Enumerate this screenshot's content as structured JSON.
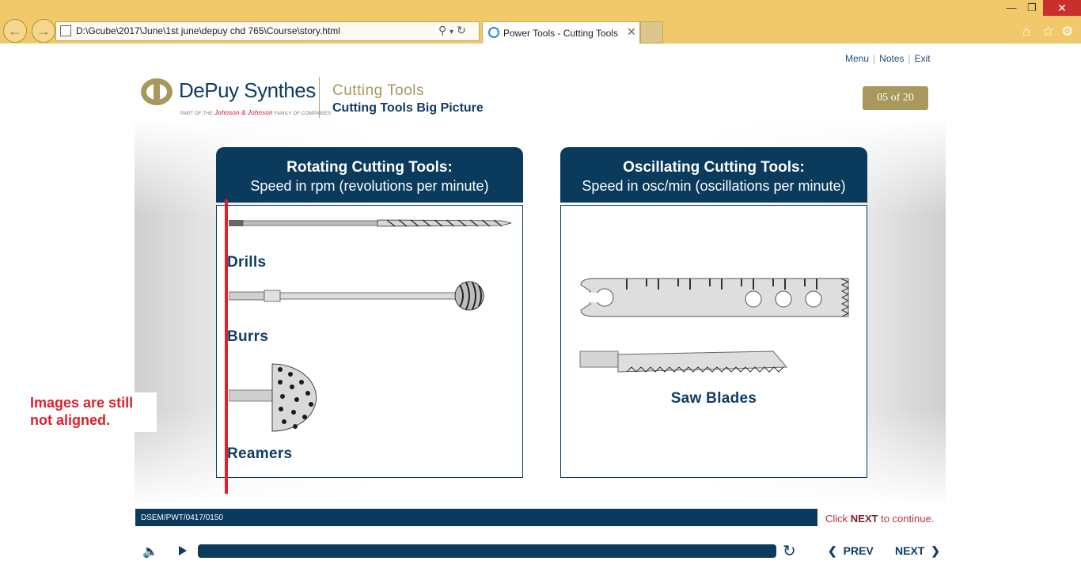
{
  "browser": {
    "address": "D:\\Gcube\\2017\\June\\1st june\\depuy chd 765\\Course\\story.html",
    "tab_title": "Power Tools - Cutting Tools"
  },
  "top_links": {
    "menu": "Menu",
    "notes": "Notes",
    "exit": "Exit"
  },
  "brand": {
    "logo": "DePuy Synthes",
    "tagline_prefix": "PART OF THE",
    "tagline_jj": "Johnson & Johnson",
    "tagline_suffix": "FAMILY OF COMPANIES"
  },
  "course": {
    "title": "Cutting Tools",
    "subtitle": "Cutting Tools Big Picture",
    "page": "05 of 20"
  },
  "panels": {
    "rotating": {
      "heading": "Rotating Cutting Tools:",
      "subheading": "Speed in rpm (revolutions per minute)",
      "items": [
        "Drills",
        "Burrs",
        "Reamers"
      ]
    },
    "oscillating": {
      "heading": "Oscillating Cutting Tools:",
      "subheading": "Speed in osc/min (oscillations per minute)",
      "items": [
        "Saw Blades"
      ]
    }
  },
  "annotation": {
    "line1": "Images are still",
    "line2": "not aligned."
  },
  "footer": {
    "code": "DSEM/PWT/0417/0150",
    "continue_pre": "Click",
    "continue_key": "NEXT",
    "continue_post": "to continue.",
    "prev": "PREV",
    "next": "NEXT"
  },
  "icons": [
    "back-icon",
    "forward-icon",
    "search-icon",
    "refresh-icon",
    "ie-icon",
    "close-icon",
    "home-icon",
    "star-icon",
    "gear-icon",
    "speaker-icon",
    "play-icon",
    "replay-icon",
    "chevron-left-icon",
    "chevron-right-icon"
  ],
  "colors": {
    "navy": "#0a3a5c",
    "gold": "#a8985c",
    "annotation_red": "#e0202a",
    "chrome": "#f1c86a"
  }
}
